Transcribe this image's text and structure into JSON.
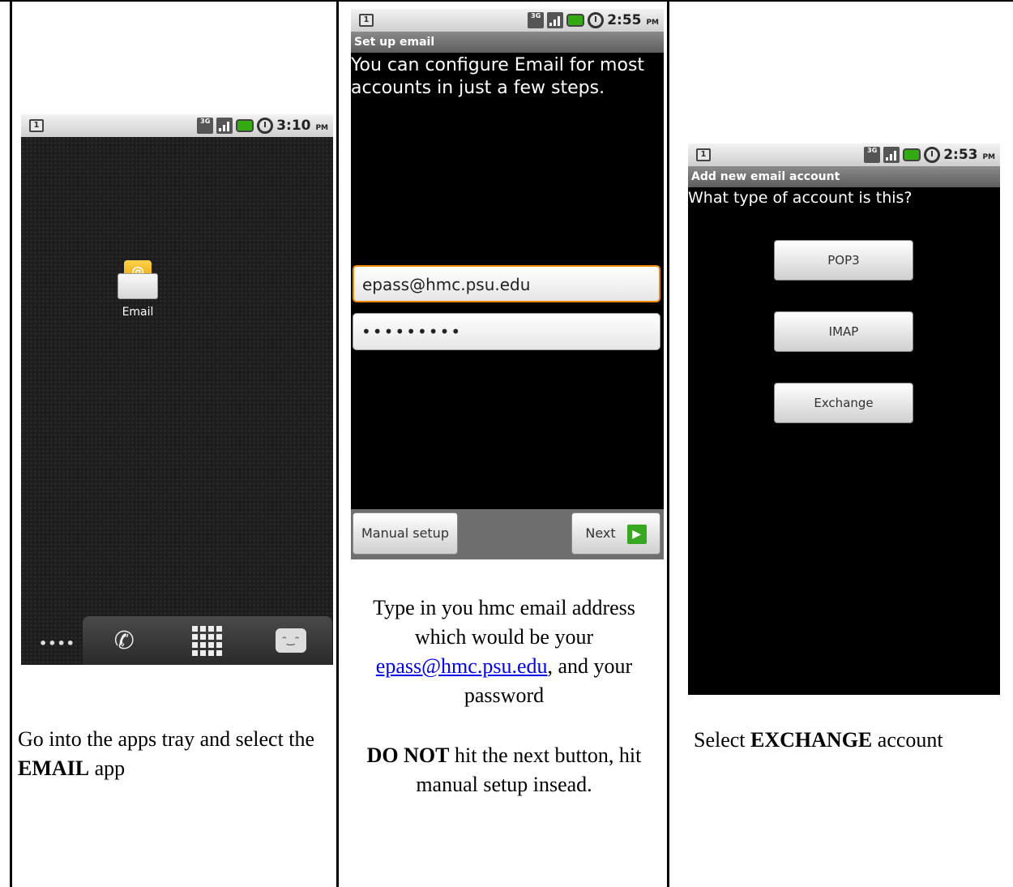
{
  "colors": {
    "accent_focus": "#f08a00",
    "next_arrow": "#38a820",
    "link": "#0000ee"
  },
  "col1": {
    "phone": {
      "status": {
        "notification": "1",
        "network": "3G",
        "time": "3:10",
        "ampm": "PM"
      },
      "app_label": "Email",
      "dock": {
        "dots": "••••"
      }
    },
    "caption": {
      "pre": "Go into the apps tray and select the ",
      "bold": "EMAIL",
      "post": " app"
    }
  },
  "col2": {
    "phone": {
      "status": {
        "notification": "1",
        "network": "3G",
        "time": "2:55",
        "ampm": "PM"
      },
      "title": "Set up email",
      "intro": "You can configure Email for most\naccounts in just a few steps.",
      "email_value": "epass@hmc.psu.edu",
      "password_value": "•••••••••",
      "manual_setup_label": "Manual setup",
      "next_label": "Next"
    },
    "caption": {
      "line_pre": "Type in you hmc email address which would be your ",
      "link": "epass@hmc.psu.edu",
      "line_post": ", and your password",
      "warn_bold": "DO NOT",
      "warn_rest": " hit the next button, hit manual setup insead."
    }
  },
  "col3": {
    "phone": {
      "status": {
        "notification": "1",
        "network": "3G",
        "time": "2:53",
        "ampm": "PM"
      },
      "title": "Add new email account",
      "question": "What type of account is this?",
      "options": [
        "POP3",
        "IMAP",
        "Exchange"
      ]
    },
    "caption": {
      "pre": "Select ",
      "bold": "EXCHANGE",
      "post": " account"
    }
  }
}
